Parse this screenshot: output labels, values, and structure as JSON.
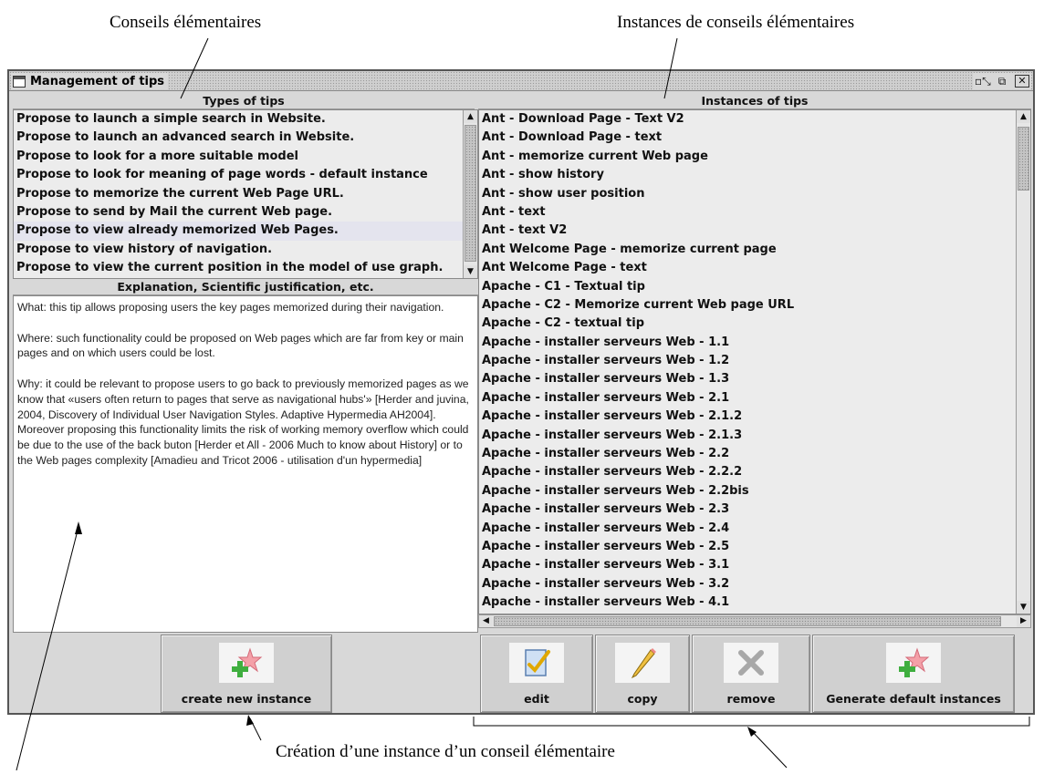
{
  "annotations": {
    "top_left": "Conseils élémentaires",
    "top_right": "Instances de conseils élémentaires",
    "bottom": "Création d’une instance d’un conseil élémentaire"
  },
  "window": {
    "title": "Management of tips",
    "icon": "window-icon",
    "controls": [
      "minimize-icon",
      "maximize-icon",
      "close-icon"
    ]
  },
  "types_panel": {
    "header": "Types of tips",
    "items": [
      "Propose to launch a simple search in Website.",
      "Propose to launch an advanced search in Website.",
      "Propose to look for a more suitable model",
      "Propose to look for meaning of page words - default instance",
      "Propose to memorize the current Web Page URL.",
      "Propose to send by Mail the current Web page.",
      "Propose to view already memorized Web Pages.",
      "Propose to view history of navigation.",
      "Propose to view the current position in the model of use graph."
    ],
    "selected_index": 6
  },
  "explanation_panel": {
    "header": "Explanation, Scientific justification, etc.",
    "text": "What: this tip allows proposing users the key pages memorized during their navigation.\n\nWhere: such functionality could be proposed on Web pages which are far from key or main pages and on which users could be lost.\n\nWhy: it could be relevant to propose users to go back to previously memorized pages as we know that «users often return to pages that serve as navigational hubs'» [Herder and juvina, 2004, Discovery of Individual User Navigation Styles. Adaptive Hypermedia AH2004]. Moreover proposing this functionality limits the risk of working memory overflow which could be due to the use of the back buton [Herder et All - 2006 Much to know about History] or to the Web pages complexity [Amadieu and Tricot 2006 - utilisation d'un hypermedia]"
  },
  "instances_panel": {
    "header": "Instances of tips",
    "items": [
      "Ant - Download Page - Text V2",
      "Ant - Download Page - text",
      "Ant - memorize current Web page",
      "Ant - show history",
      "Ant - show user position",
      "Ant - text",
      "Ant - text V2",
      "Ant Welcome Page - memorize current page",
      "Ant Welcome Page - text",
      "Apache - C1 - Textual tip",
      "Apache - C2 - Memorize current Web page URL",
      "Apache - C2 - textual tip",
      "Apache - installer serveurs Web - 1.1",
      "Apache - installer serveurs Web - 1.2",
      "Apache - installer serveurs Web - 1.3",
      "Apache - installer serveurs Web - 2.1",
      "Apache - installer serveurs Web - 2.1.2",
      "Apache - installer serveurs Web - 2.1.3",
      "Apache - installer serveurs Web - 2.2",
      "Apache - installer serveurs Web - 2.2.2",
      "Apache - installer serveurs Web - 2.2bis",
      "Apache - installer serveurs Web - 2.3",
      "Apache - installer serveurs Web - 2.4",
      "Apache - installer serveurs Web - 2.5",
      "Apache - installer serveurs Web - 3.1",
      "Apache - installer serveurs Web - 3.2",
      "Apache - installer serveurs Web - 4.1"
    ]
  },
  "buttons": {
    "create": {
      "label": "create new instance",
      "icon": "add-star-icon"
    },
    "edit": {
      "label": "edit",
      "icon": "edit-document-icon"
    },
    "copy": {
      "label": "copy",
      "icon": "pencil-icon"
    },
    "remove": {
      "label": "remove",
      "icon": "remove-x-icon"
    },
    "generate": {
      "label": "Generate default instances",
      "icon": "add-star-icon"
    }
  },
  "colors": {
    "window_bg": "#d8d8d8",
    "list_bg": "#ececec",
    "selected_row": "#e4e4ee",
    "add_icon_green": "#3fae3f",
    "star_pink": "#f4a0a8"
  }
}
